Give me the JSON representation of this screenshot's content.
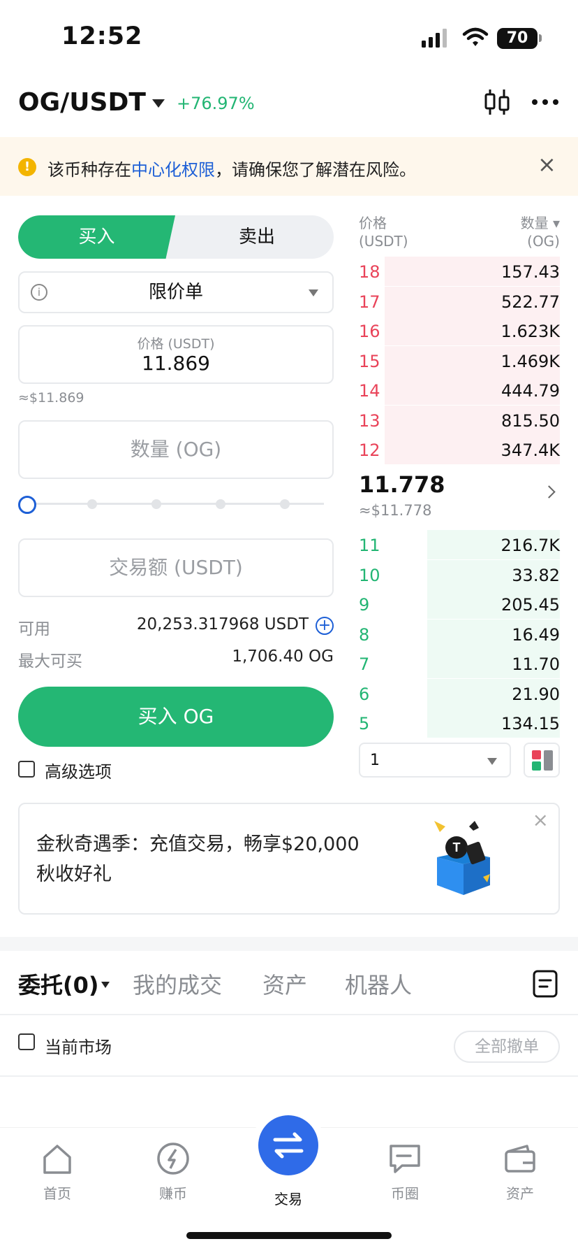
{
  "status_bar": {
    "time": "12:52",
    "battery": "70"
  },
  "header": {
    "pair": "OG/USDT",
    "change": "+76.97%"
  },
  "risk_banner": {
    "text_before": "该币种存在",
    "link": "中心化权限",
    "text_after": "，请确保您了解潜在风险。",
    "close": "×"
  },
  "trade_form": {
    "buy_tab": "买入",
    "sell_tab": "卖出",
    "order_type": "限价单",
    "price_label": "价格 (USDT)",
    "price_value": "11.869",
    "price_usd": "≈$11.869",
    "amount_placeholder": "数量 (OG)",
    "slider_percent": 0,
    "total_placeholder": "交易额 (USDT)",
    "available_label": "可用",
    "available_value": "20,253.317968 USDT",
    "max_buy_label": "最大可买",
    "max_buy_value": "1,706.40 OG",
    "buy_button": "买入 OG",
    "advanced_label": "高级选项"
  },
  "order_book": {
    "header_price": [
      "价格",
      "(USDT)"
    ],
    "header_qty": [
      "数量 ▾",
      "(OG)"
    ],
    "asks": [
      {
        "price": "18",
        "qty": "157.43",
        "depth": 0.87
      },
      {
        "price": "17",
        "qty": "522.77",
        "depth": 0.87
      },
      {
        "price": "16",
        "qty": "1.623K",
        "depth": 0.87
      },
      {
        "price": "15",
        "qty": "1.469K",
        "depth": 0.87
      },
      {
        "price": "14",
        "qty": "444.79",
        "depth": 0.87
      },
      {
        "price": "13",
        "qty": "815.50",
        "depth": 0.87
      },
      {
        "price": "12",
        "qty": "347.4K",
        "depth": 0.87
      }
    ],
    "mid_price": "11.778",
    "mid_usd": "≈$11.778",
    "bids": [
      {
        "price": "11",
        "qty": "216.7K",
        "depth": 0.66
      },
      {
        "price": "10",
        "qty": "33.82",
        "depth": 0.66
      },
      {
        "price": "9",
        "qty": "205.45",
        "depth": 0.66
      },
      {
        "price": "8",
        "qty": "16.49",
        "depth": 0.66
      },
      {
        "price": "7",
        "qty": "11.70",
        "depth": 0.66
      },
      {
        "price": "6",
        "qty": "21.90",
        "depth": 0.66
      },
      {
        "price": "5",
        "qty": "134.15",
        "depth": 0.66
      }
    ],
    "precision": "1"
  },
  "promo": {
    "line1": "金秋奇遇季：充值交易，畅享$20,000",
    "line2": "秋收好礼",
    "close": "×"
  },
  "orders_tabs": {
    "entrust": "委托(0)",
    "my_trades": "我的成交",
    "assets": "资产",
    "bot": "机器人"
  },
  "market_filter": {
    "label": "当前市场",
    "cancel_all": "全部撤单"
  },
  "bottom_nav": {
    "home": "首页",
    "earn": "赚币",
    "trade": "交易",
    "community": "币圈",
    "assets": "资产"
  },
  "colors": {
    "green": "#24b774",
    "red": "#e94359",
    "blue": "#1d5fd6",
    "trade_blue": "#2f6be8"
  }
}
